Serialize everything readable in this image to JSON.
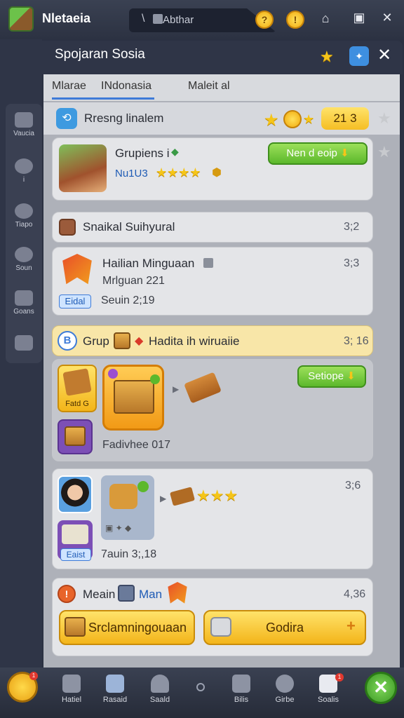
{
  "app": {
    "title": "Nletaeia",
    "search_text": "Abthar",
    "window_title": "Spojaran Sosia"
  },
  "tabs": [
    {
      "label": "Mlarae"
    },
    {
      "label": "INdonasia"
    },
    {
      "label": "Maleit al"
    }
  ],
  "section1": {
    "title": "Rresng linalem",
    "score": "21 3"
  },
  "card1": {
    "title": "Grupiens i",
    "tag": "Nu1U3",
    "button": "Nen d eoip",
    "stars": 4
  },
  "section2": {
    "title": "Snaikal Suihyural",
    "value": "3;2"
  },
  "card2": {
    "title": "Hailian Minguaan",
    "subtitle": "Mrlguan 221",
    "chip": "Eidal",
    "meta": "Seuin 2;19",
    "value": "3;3"
  },
  "section3": {
    "title_a": "Grup",
    "title_b": "Hadita ih wiruaiie",
    "value": "3; 16"
  },
  "card3": {
    "button": "Setiope",
    "tile_label": "Fatd G",
    "caption": "Fadivhee 017"
  },
  "card4": {
    "value": "3;6",
    "chip": "Eaist",
    "meta": "7auin 3;,18",
    "stars": 3
  },
  "section4": {
    "title_a": "Meain",
    "title_b": "Man",
    "value": "4,36",
    "btn_left": "Srclamningouaan",
    "btn_right": "Godira"
  },
  "sidebar": [
    {
      "label": "Vaucia"
    },
    {
      "label": "i"
    },
    {
      "label": "Tiapo"
    },
    {
      "label": "Soun"
    },
    {
      "label": "Goans"
    },
    {
      "label": ""
    }
  ],
  "bottom_nav": [
    {
      "label": "Hatiel"
    },
    {
      "label": "Rasaid"
    },
    {
      "label": "Saald"
    },
    {
      "label": ""
    },
    {
      "label": "Bilis"
    },
    {
      "label": "Girbe"
    },
    {
      "label": "Soalis"
    }
  ],
  "colors": {
    "accent_blue": "#3e7bd8",
    "green": "#5cb82c",
    "gold": "#f5c518",
    "bg": "#2b3142"
  }
}
